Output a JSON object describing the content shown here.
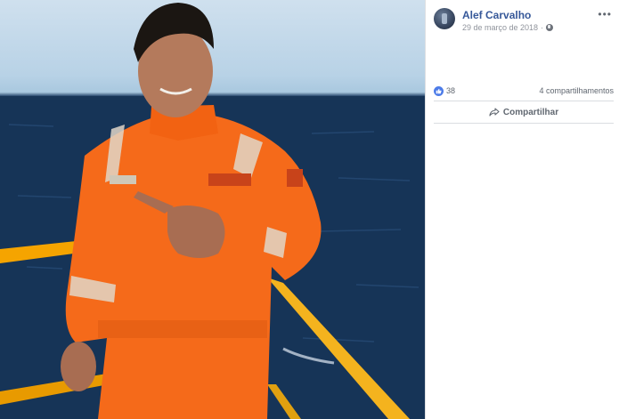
{
  "post": {
    "author": "Alef Carvalho",
    "date": "29 de março de 2018",
    "date_separator": "·"
  },
  "stats": {
    "likes": "38",
    "shares": "4 compartilhamentos"
  },
  "actions": {
    "share_label": "Compartilhar"
  },
  "icons": [
    "globe-icon",
    "more-options-icon",
    "like-icon",
    "share-icon",
    "avatar"
  ],
  "colors": {
    "author_link": "#365899",
    "meta_text": "#90949c",
    "like_blue": "#4d7ce8",
    "divider": "#dadde1"
  }
}
